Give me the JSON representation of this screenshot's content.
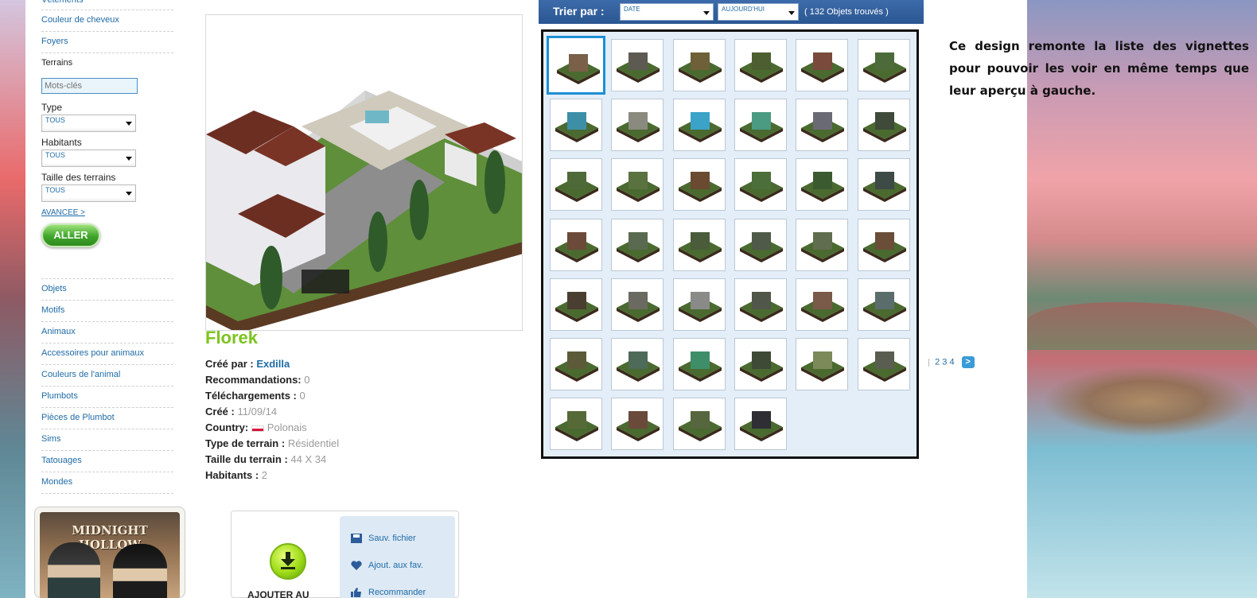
{
  "sidebar": {
    "top_links": [
      "Vêtements",
      "Couleur de cheveux",
      "Foyers"
    ],
    "current_section": "Terrains",
    "keyword_placeholder": "Mots-clés",
    "filters": [
      {
        "label": "Type",
        "value": "TOUS"
      },
      {
        "label": "Habitants",
        "value": "TOUS"
      },
      {
        "label": "Taille des terrains",
        "value": "TOUS"
      }
    ],
    "advanced_label": "AVANCEE >",
    "go_label": "ALLER",
    "categories": [
      "Objets",
      "Motifs",
      "Animaux",
      "Accessoires pour animaux",
      "Couleurs de l'animal",
      "Plumbots",
      "Pièces de Plumbot",
      "Sims",
      "Tatouages",
      "Mondes"
    ]
  },
  "promo": {
    "title": "MIDNIGHT HOLLOW"
  },
  "item": {
    "title": "Florek",
    "meta": [
      {
        "label": "Créé par :",
        "value": "Exdilla",
        "type": "link"
      },
      {
        "label": "Recommandations:",
        "value": "0",
        "type": "plain"
      },
      {
        "label": "Téléchargements :",
        "value": "0",
        "type": "plain"
      },
      {
        "label": "Créé :",
        "value": "11/09/14",
        "type": "plain"
      },
      {
        "label": "Country:",
        "value": "Polonais",
        "type": "flag"
      },
      {
        "label": "Type de terrain :",
        "value": "Résidentiel",
        "type": "plain"
      },
      {
        "label": "Taille du terrain :",
        "value": "44 X 34",
        "type": "plain"
      },
      {
        "label": "Habitants :",
        "value": "2",
        "type": "plain"
      }
    ]
  },
  "download": {
    "label": "AJOUTER AU",
    "actions": [
      "Sauv. fichier",
      "Ajout. aux fav.",
      "Recommander"
    ]
  },
  "sort": {
    "label": "Trier par :",
    "by": "DATE",
    "period": "AUJOURD'HUI",
    "count": "( 132 Objets trouvés )"
  },
  "grid": {
    "thumbs": [
      {
        "color": "#7a6048"
      },
      {
        "color": "#5d5a52"
      },
      {
        "color": "#6e6038"
      },
      {
        "color": "#4d5e30"
      },
      {
        "color": "#7a4a3c"
      },
      {
        "color": "#4d6a3a"
      },
      {
        "color": "#3d8fa8"
      },
      {
        "color": "#8b8a7e"
      },
      {
        "color": "#3aa3c7"
      },
      {
        "color": "#4b9a82"
      },
      {
        "color": "#6a6a74"
      },
      {
        "color": "#3f4a3a"
      },
      {
        "color": "#4e6a38"
      },
      {
        "color": "#5a7240"
      },
      {
        "color": "#6a4a30"
      },
      {
        "color": "#4c6e3a"
      },
      {
        "color": "#3c5a30"
      },
      {
        "color": "#3e4a46"
      },
      {
        "color": "#6b4a3a"
      },
      {
        "color": "#5a6a50"
      },
      {
        "color": "#4a5c3a"
      },
      {
        "color": "#4f5a48"
      },
      {
        "color": "#606d4e"
      },
      {
        "color": "#6a4e38"
      },
      {
        "color": "#4a3e30"
      },
      {
        "color": "#6a6a60"
      },
      {
        "color": "#8a8a88"
      },
      {
        "color": "#50574a"
      },
      {
        "color": "#7a5a48"
      },
      {
        "color": "#5b6d6a"
      },
      {
        "color": "#5c5a38"
      },
      {
        "color": "#4e6a58"
      },
      {
        "color": "#3f8e6a"
      },
      {
        "color": "#3e4a36"
      },
      {
        "color": "#7c8a5a"
      },
      {
        "color": "#5a5e50"
      },
      {
        "color": "#566a38"
      },
      {
        "color": "#6a4a3a"
      },
      {
        "color": "#56663e"
      },
      {
        "color": "#2e2e34"
      }
    ],
    "pages": [
      "2",
      "3",
      "4"
    ],
    "next_label": ">"
  },
  "note": "Ce design remonte la liste des vignettes pour pouvoir les voir en même temps que leur aperçu à gauche."
}
